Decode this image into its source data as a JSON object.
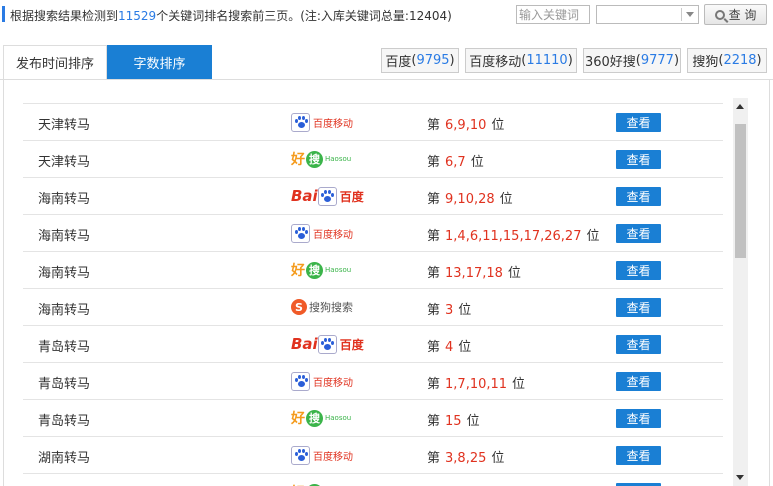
{
  "summary": {
    "prefix": "根据搜索结果检测到",
    "matched_count": "11529",
    "suffix": "个关键词排名搜索前三页。(注:入库关键词总量:12404)"
  },
  "search": {
    "keyword_placeholder": "输入关键词",
    "engine_selected": "",
    "button_label": "查 询"
  },
  "tabs": [
    {
      "label": "发布时间排序",
      "active": false
    },
    {
      "label": "字数排序",
      "active": true
    }
  ],
  "engine_filters": [
    {
      "name": "百度",
      "count": "9795"
    },
    {
      "name": "百度移动",
      "count": "11110"
    },
    {
      "name": "360好搜",
      "count": "9777"
    },
    {
      "name": "搜狗",
      "count": "2218"
    }
  ],
  "rank_prefix": "第",
  "rank_suffix": "位",
  "view_label": "查看",
  "rows": [
    {
      "keyword": "天津转马",
      "engine": "baidu-mobile",
      "positions": "6,9,10"
    },
    {
      "keyword": "天津转马",
      "engine": "haosou",
      "positions": "6,7"
    },
    {
      "keyword": "海南转马",
      "engine": "baidu",
      "positions": "9,10,28"
    },
    {
      "keyword": "海南转马",
      "engine": "baidu-mobile",
      "positions": "1,4,6,11,15,17,26,27"
    },
    {
      "keyword": "海南转马",
      "engine": "haosou",
      "positions": "13,17,18"
    },
    {
      "keyword": "海南转马",
      "engine": "sogou",
      "positions": "3"
    },
    {
      "keyword": "青岛转马",
      "engine": "baidu",
      "positions": "4"
    },
    {
      "keyword": "青岛转马",
      "engine": "baidu-mobile",
      "positions": "1,7,10,11"
    },
    {
      "keyword": "青岛转马",
      "engine": "haosou",
      "positions": "15"
    },
    {
      "keyword": "湖南转马",
      "engine": "baidu-mobile",
      "positions": "3,8,25"
    },
    {
      "keyword": "湖南转马",
      "engine": "haosou",
      "positions": ""
    }
  ],
  "logos": {
    "baidu-mobile": {
      "text": "百度移动"
    },
    "haosou": {
      "hao": "好",
      "sou": "搜",
      "en": "Haosou"
    },
    "baidu": {
      "bai": "Bai",
      "du": "百度"
    },
    "sogou": {
      "s": "S",
      "text": "搜狗搜索"
    }
  },
  "colors": {
    "accent_blue": "#1a7fd4",
    "link_blue": "#2a7be4",
    "rank_red": "#e0321f"
  }
}
